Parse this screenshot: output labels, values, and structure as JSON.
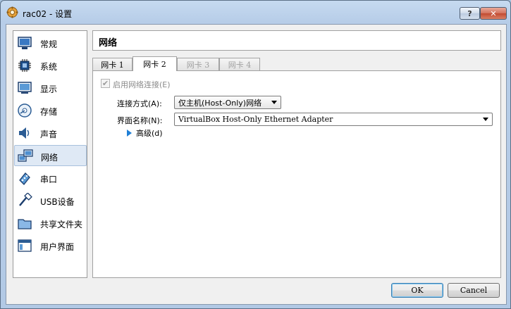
{
  "window": {
    "title": "rac02 - 设置",
    "help_label": "?",
    "close_label": "✕"
  },
  "sidebar": {
    "items": [
      {
        "label": "常规",
        "icon": "general-icon"
      },
      {
        "label": "系统",
        "icon": "chip-icon"
      },
      {
        "label": "显示",
        "icon": "monitor-icon"
      },
      {
        "label": "存储",
        "icon": "disk-icon"
      },
      {
        "label": "声音",
        "icon": "speaker-icon"
      },
      {
        "label": "网络",
        "icon": "network-icon"
      },
      {
        "label": "串口",
        "icon": "serial-port-icon"
      },
      {
        "label": "USB设备",
        "icon": "usb-icon"
      },
      {
        "label": "共享文件夹",
        "icon": "folder-icon"
      },
      {
        "label": "用户界面",
        "icon": "ui-icon"
      }
    ],
    "selected": "网络"
  },
  "content": {
    "title": "网络",
    "tabs": [
      {
        "label": "网卡 1",
        "state": "normal"
      },
      {
        "label": "网卡 2",
        "state": "active"
      },
      {
        "label": "网卡 3",
        "state": "disabled"
      },
      {
        "label": "网卡 4",
        "state": "disabled"
      }
    ],
    "enable_checkbox_label": "启用网络连接(E)",
    "enable_checked": true,
    "attach_label": "连接方式(A):",
    "attach_value": "仅主机(Host-Only)网络",
    "name_label": "界面名称(N):",
    "name_value": "VirtualBox Host-Only Ethernet Adapter",
    "advanced_label": "高级(d)"
  },
  "buttons": {
    "ok": "OK",
    "cancel": "Cancel"
  },
  "colors": {
    "title_bar": "#b7cde8",
    "accent_blue": "#1f7fd6",
    "selection": "#dfe9f5"
  }
}
